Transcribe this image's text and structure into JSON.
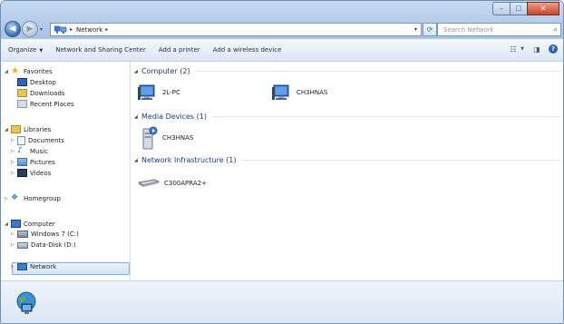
{
  "window": {
    "controls": {
      "minimize": "–",
      "maximize": "☐",
      "close": "✕"
    }
  },
  "address_bar": {
    "path": [
      "Network"
    ],
    "search_placeholder": "Search Network"
  },
  "toolbar": {
    "organize": "Organize",
    "network_sharing": "Network and Sharing Center",
    "add_printer": "Add a printer",
    "add_wireless": "Add a wireless device"
  },
  "nav_pane": {
    "favorites": {
      "label": "Favorites",
      "items": [
        "Desktop",
        "Downloads",
        "Recent Places"
      ]
    },
    "libraries": {
      "label": "Libraries",
      "items": [
        "Documents",
        "Music",
        "Pictures",
        "Videos"
      ]
    },
    "homegroup": "Homegroup",
    "computer": {
      "label": "Computer",
      "items": [
        "Windows 7 (C:)",
        "Data-Disk (D:)"
      ]
    },
    "network": "Network"
  },
  "groups": [
    {
      "title": "Computer (2)",
      "items": [
        "2L-PC",
        "CH3HNAS"
      ]
    },
    {
      "title": "Media Devices (1)",
      "items": [
        "CH3HNAS"
      ]
    },
    {
      "title": "Network Infrastructure (1)",
      "items": [
        "C300APRA2+"
      ]
    }
  ],
  "colors": {
    "accent": "#1e3b8b",
    "chrome": "#b6cde9",
    "selection": "#d2e5fa"
  }
}
